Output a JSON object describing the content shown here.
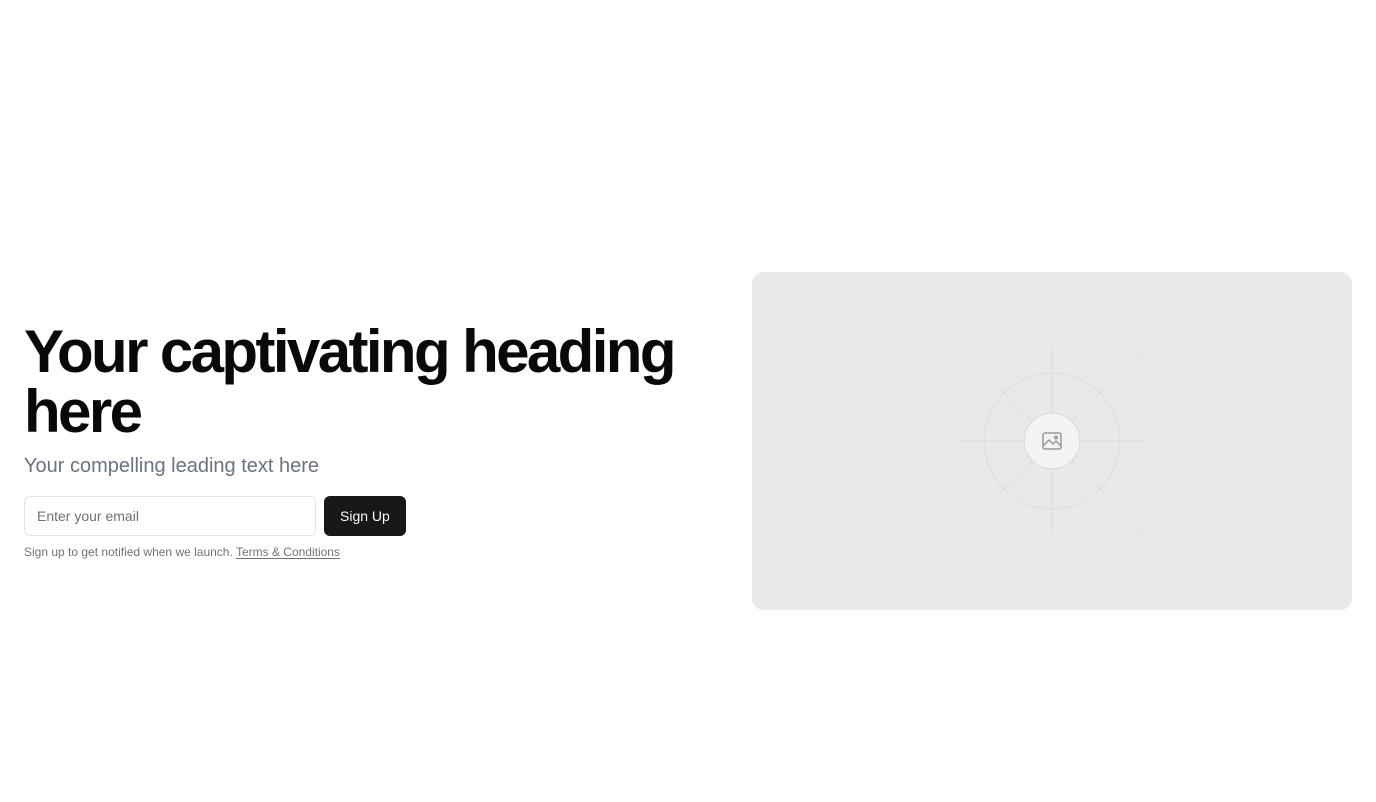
{
  "hero": {
    "heading": "Your captivating heading here",
    "lead": "Your compelling leading text here",
    "email_placeholder": "Enter your email",
    "signup_label": "Sign Up",
    "note_text": "Sign up to get notified when we launch. ",
    "terms_link": "Terms & Conditions"
  },
  "media": {
    "icon": "image-icon"
  },
  "colors": {
    "button_bg": "#18181b",
    "placeholder_bg": "#e9e9e9",
    "muted_text": "#6b7280"
  }
}
